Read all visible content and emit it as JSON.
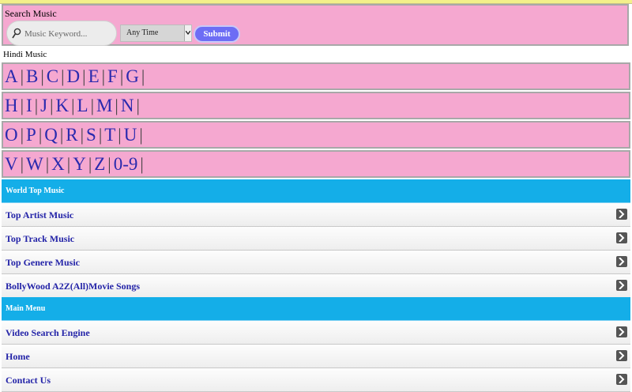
{
  "search": {
    "title": "Search Music",
    "placeholder": "Music Keyword...",
    "time_filter": "Any Time",
    "submit_label": "Submit"
  },
  "hindi": {
    "label": "Hindi Music",
    "rows": [
      [
        "A",
        "B",
        "C",
        "D",
        "E",
        "F",
        "G"
      ],
      [
        "H",
        "I",
        "J",
        "K",
        "L",
        "M",
        "N"
      ],
      [
        "O",
        "P",
        "Q",
        "R",
        "S",
        "T",
        "U"
      ],
      [
        "V",
        "W",
        "X",
        "Y",
        "Z",
        "0-9"
      ]
    ]
  },
  "world_top": {
    "header": "World Top Music",
    "items": [
      "Top Artist Music",
      "Top Track Music",
      "Top Genere Music",
      "BollyWood A2Z(All)Movie Songs"
    ]
  },
  "main_menu": {
    "header": "Main Menu",
    "items": [
      "Video Search Engine",
      "Home",
      "Contact Us"
    ]
  },
  "colors": {
    "panel_pink": "#f5a8d0",
    "header_blue": "#14aee8",
    "link_blue": "#2424a8",
    "submit_purple": "#6d6df5"
  },
  "icons": {
    "search": "search-icon",
    "row_arrow": "chevron-right-icon",
    "dropdown": "chevron-down-icon"
  }
}
